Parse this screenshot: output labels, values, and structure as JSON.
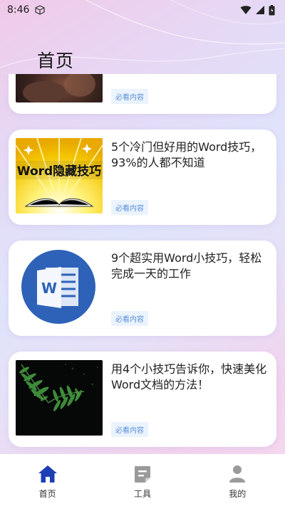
{
  "status_bar": {
    "time": "8:46",
    "icons": [
      "cube-icon",
      "wifi-icon",
      "signal-icon",
      "battery-icon"
    ]
  },
  "header": {
    "title": "首页"
  },
  "articles": [
    {
      "title": "",
      "tag": "必看内容",
      "thumb": "photo-dark"
    },
    {
      "title": "5个冷门但好用的Word技巧，93%的人都不知道",
      "tag": "必看内容",
      "thumb": "word-hidden-tricks-banner",
      "thumb_text": "Word隐藏技巧"
    },
    {
      "title": "9个超实用Word小技巧，轻松完成一天的工作",
      "tag": "必看内容",
      "thumb": "word-logo"
    },
    {
      "title": "用4个小技巧告诉你，快速美化Word文档的方法！",
      "tag": "必看内容",
      "thumb": "fern-photo"
    }
  ],
  "tabbar": {
    "items": [
      {
        "label": "首页",
        "icon": "home-icon",
        "active": true
      },
      {
        "label": "工具",
        "icon": "tools-icon",
        "active": false
      },
      {
        "label": "我的",
        "icon": "profile-icon",
        "active": false
      }
    ]
  },
  "colors": {
    "active_tab": "#1e3fb4",
    "inactive_tab": "#9a9a9a",
    "tag_bg": "#eaf3fe",
    "tag_text": "#5a8fd6"
  }
}
